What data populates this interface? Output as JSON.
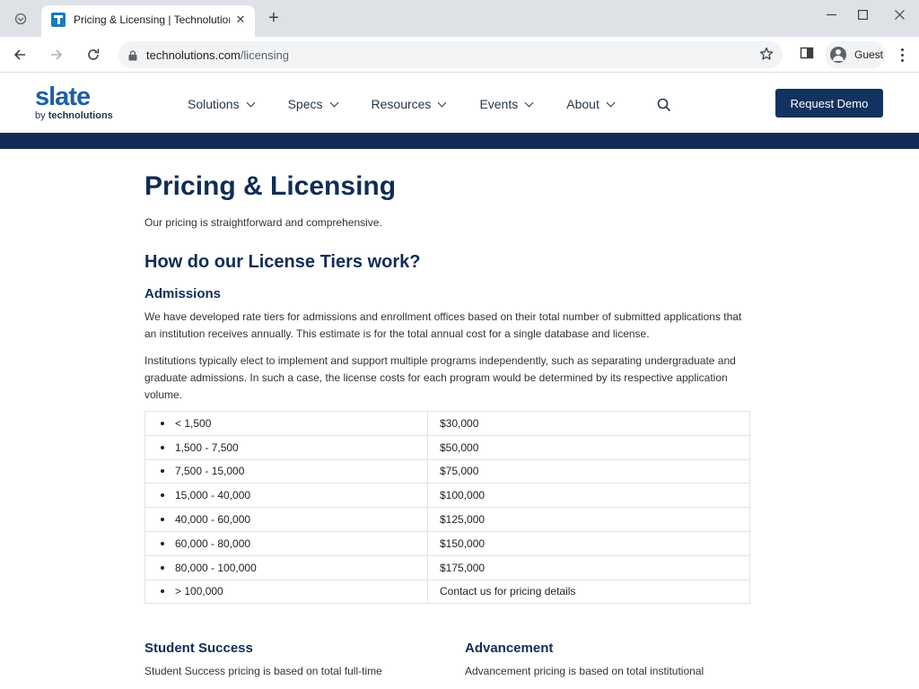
{
  "browser": {
    "tab_title": "Pricing & Licensing | Technolutions",
    "close_glyph": "✕",
    "new_tab_glyph": "+",
    "url_host": "technolutions.com",
    "url_path": "/licensing",
    "profile_name": "Guest",
    "icons": [
      "tab-search-icon",
      "favicon",
      "close-icon",
      "plus-icon",
      "minimize-icon",
      "maximize-icon",
      "close-window-icon",
      "back-icon",
      "forward-icon",
      "reload-icon",
      "lock-icon",
      "star-icon",
      "side-panel-icon",
      "avatar",
      "kebab-menu-icon"
    ]
  },
  "site": {
    "logo_main": "slate",
    "logo_by": "by ",
    "logo_company": "technolutions",
    "nav": [
      {
        "label": "Solutions"
      },
      {
        "label": "Specs"
      },
      {
        "label": "Resources"
      },
      {
        "label": "Events"
      },
      {
        "label": "About"
      }
    ],
    "cta_label": "Request Demo",
    "colors": {
      "navy": "#102d57",
      "logo_blue": "#1d5fa8"
    }
  },
  "page": {
    "title": "Pricing & Licensing",
    "intro": "Our pricing is straightforward and comprehensive.",
    "tiers_heading": "How do our License Tiers work?",
    "admissions": {
      "heading": "Admissions",
      "para1": "We have developed rate tiers for admissions and enrollment offices based on their total number of submitted applications that an institution receives annually. This estimate is for the total annual cost for a single database and license.",
      "para2": "Institutions typically elect to implement and support multiple programs independently, such as separating undergraduate and graduate admissions. In such a case, the license costs for each program would be determined by its respective application volume."
    },
    "tiers": [
      {
        "range": "< 1,500",
        "price": "$30,000"
      },
      {
        "range": "1,500 - 7,500",
        "price": "$50,000"
      },
      {
        "range": "7,500 - 15,000",
        "price": "$75,000"
      },
      {
        "range": "15,000 - 40,000",
        "price": "$100,000"
      },
      {
        "range": "40,000 - 60,000",
        "price": "$125,000"
      },
      {
        "range": "60,000 - 80,000",
        "price": "$150,000"
      },
      {
        "range": "80,000 - 100,000",
        "price": "$175,000"
      },
      {
        "range": "> 100,000",
        "price": "Contact us for pricing details"
      }
    ],
    "student_success": {
      "heading": "Student Success",
      "text": "Student Success pricing is based on total full-time"
    },
    "advancement": {
      "heading": "Advancement",
      "text": "Advancement pricing is based on total institutional"
    }
  }
}
